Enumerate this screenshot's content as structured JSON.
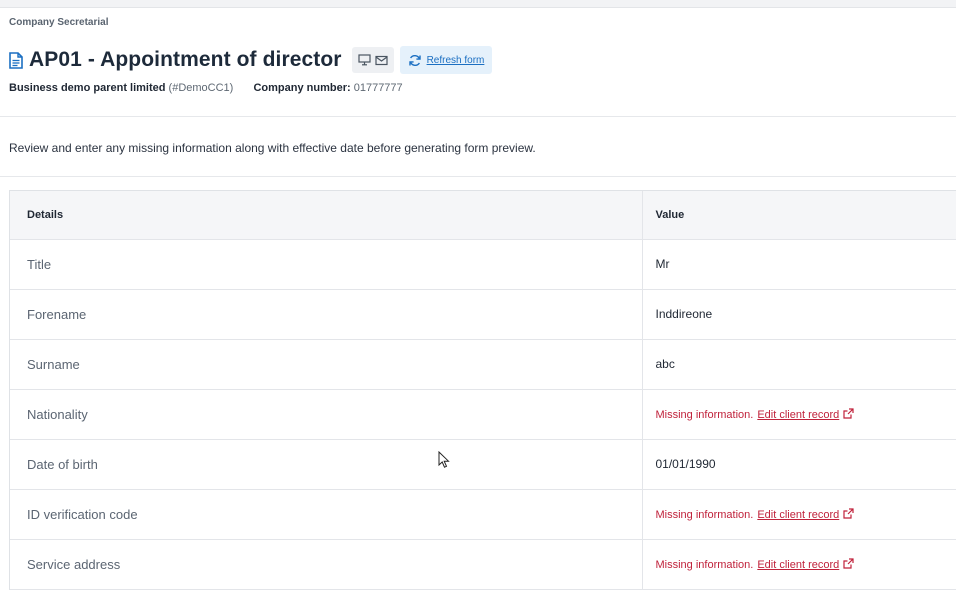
{
  "breadcrumb": "Company Secretarial",
  "title": "AP01 - Appointment of director",
  "toolbar": {
    "icons": [
      "monitor-icon",
      "mail-icon",
      "refresh-icon"
    ],
    "refresh_label": "Refresh form"
  },
  "company": {
    "name": "Business demo parent limited",
    "code": "(#DemoCC1)",
    "number_label": "Company number:",
    "number": "01777777"
  },
  "instruction": "Review and enter any missing information along with effective date before generating form preview.",
  "table": {
    "headers": [
      "Details",
      "Value"
    ],
    "rows": [
      {
        "detail": "Title",
        "value": "Mr"
      },
      {
        "detail": "Forename",
        "value": "Inddireone"
      },
      {
        "detail": "Surname",
        "value": "abc"
      },
      {
        "detail": "Nationality",
        "missing": "Missing information.",
        "link": "Edit client record"
      },
      {
        "detail": "Date of birth",
        "value": "01/01/1990"
      },
      {
        "detail": "ID verification code",
        "missing": "Missing information.",
        "link": "Edit client record"
      },
      {
        "detail": "Service address",
        "missing": "Missing information.",
        "link": "Edit client record"
      }
    ]
  },
  "colors": {
    "accent": "#1b6fc2",
    "missing": "#c0223b",
    "header_bg": "#f5f6f8"
  }
}
